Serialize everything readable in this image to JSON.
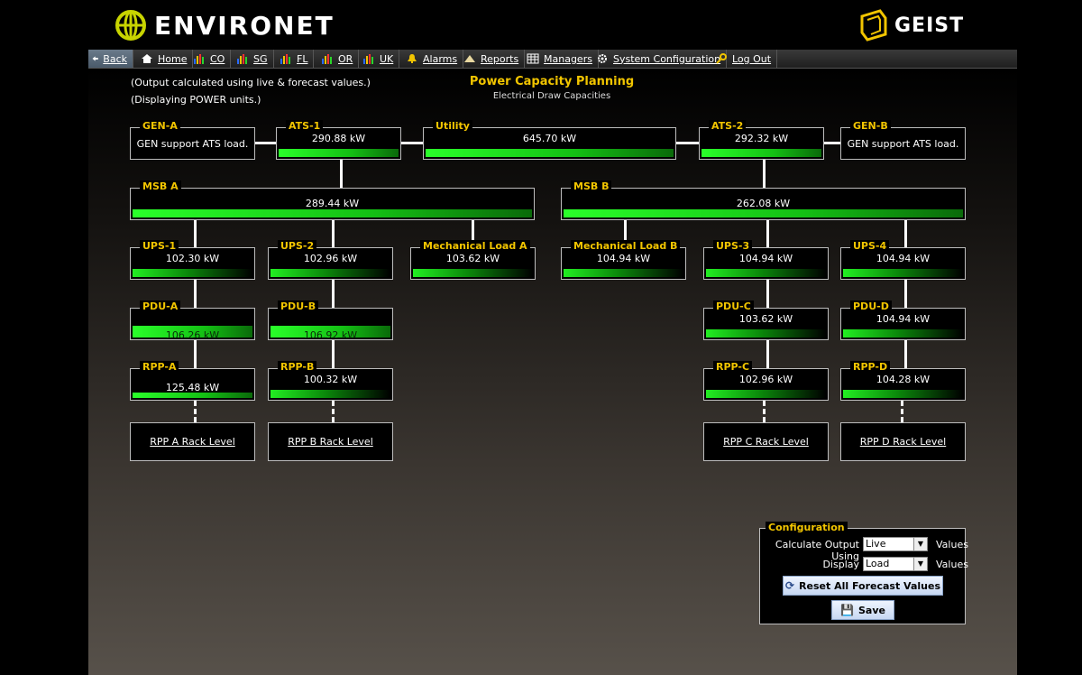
{
  "header": {
    "brand": "ENVIRONET",
    "partner": "GEIST"
  },
  "nav": {
    "back": "Back",
    "home": "Home",
    "co": "CO",
    "sg": "SG",
    "fl": "FL",
    "or": "OR",
    "uk": "UK",
    "alarms": "Alarms",
    "reports": "Reports",
    "managers": "Managers",
    "system_config": "System Configuration",
    "logout": "Log Out"
  },
  "info": {
    "line1": "(Output calculated using live & forecast values.)",
    "line2": "(Displaying POWER units.)"
  },
  "page": {
    "title": "Power Capacity Planning",
    "subtitle": "Electrical Draw Capacities"
  },
  "nodes": {
    "gen_a": {
      "label": "GEN-A",
      "text": "GEN support ATS load."
    },
    "ats_1": {
      "label": "ATS-1",
      "value": "290.88 kW",
      "fill": 1.0
    },
    "utility": {
      "label": "Utility",
      "value": "645.70 kW",
      "fill": 1.0
    },
    "ats_2": {
      "label": "ATS-2",
      "value": "292.32 kW",
      "fill": 1.0
    },
    "gen_b": {
      "label": "GEN-B",
      "text": "GEN support ATS load."
    },
    "msb_a": {
      "label": "MSB A",
      "value": "289.44 kW",
      "fill": 1.0
    },
    "msb_b": {
      "label": "MSB B",
      "value": "262.08 kW",
      "fill": 1.0
    },
    "ups_1": {
      "label": "UPS-1",
      "value": "102.30 kW",
      "fill": 1.0
    },
    "ups_2": {
      "label": "UPS-2",
      "value": "102.96 kW",
      "fill": 1.0
    },
    "mech_a": {
      "label": "Mechanical Load A",
      "value": "103.62 kW",
      "fill": 1.0
    },
    "mech_b": {
      "label": "Mechanical Load B",
      "value": "104.94 kW",
      "fill": 1.0
    },
    "ups_3": {
      "label": "UPS-3",
      "value": "104.94 kW",
      "fill": 1.0
    },
    "ups_4": {
      "label": "UPS-4",
      "value": "104.94 kW",
      "fill": 1.0
    },
    "pdu_a": {
      "label": "PDU-A",
      "value": "106.26 kW",
      "fill": 1.0
    },
    "pdu_b": {
      "label": "PDU-B",
      "value": "106.92 kW",
      "fill": 1.0
    },
    "pdu_c": {
      "label": "PDU-C",
      "value": "103.62 kW",
      "fill": 1.0
    },
    "pdu_d": {
      "label": "PDU-D",
      "value": "104.94 kW",
      "fill": 1.0
    },
    "rpp_a": {
      "label": "RPP-A",
      "value": "125.48 kW",
      "fill": 1.0
    },
    "rpp_b": {
      "label": "RPP-B",
      "value": "100.32 kW",
      "fill": 1.0
    },
    "rpp_c": {
      "label": "RPP-C",
      "value": "102.96 kW",
      "fill": 1.0
    },
    "rpp_d": {
      "label": "RPP-D",
      "value": "104.28 kW",
      "fill": 1.0
    }
  },
  "racks": {
    "a": "RPP A Rack Level",
    "b": "RPP B Rack Level",
    "c": "RPP C Rack Level",
    "d": "RPP D Rack Level"
  },
  "config": {
    "title": "Configuration",
    "calc_label": "Calculate Output Using",
    "calc_value": "Live",
    "calc_suffix": "Values",
    "display_label": "Display",
    "display_value": "Load",
    "display_suffix": "Values",
    "reset_label": "Reset All Forecast Values",
    "save_label": "Save"
  },
  "colors": {
    "accent": "#f2c500",
    "bar": "#22dd22",
    "border": "#bdbdbd"
  }
}
